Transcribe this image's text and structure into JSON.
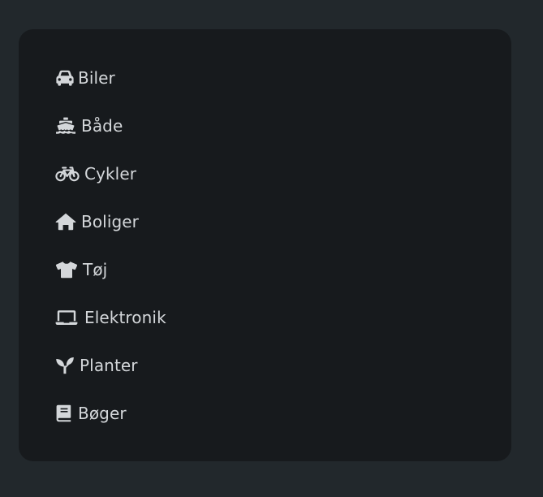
{
  "colors": {
    "page_background": "#22282c",
    "panel_background": "#171a1d",
    "text": "#d4d7da"
  },
  "categories": [
    {
      "label": "Biler",
      "icon": "car-icon"
    },
    {
      "label": "Både",
      "icon": "ship-icon"
    },
    {
      "label": "Cykler",
      "icon": "bicycle-icon"
    },
    {
      "label": "Boliger",
      "icon": "house-icon"
    },
    {
      "label": "Tøj",
      "icon": "shirt-icon"
    },
    {
      "label": "Elektronik",
      "icon": "laptop-icon"
    },
    {
      "label": "Planter",
      "icon": "seedling-icon"
    },
    {
      "label": "Bøger",
      "icon": "book-icon"
    }
  ]
}
